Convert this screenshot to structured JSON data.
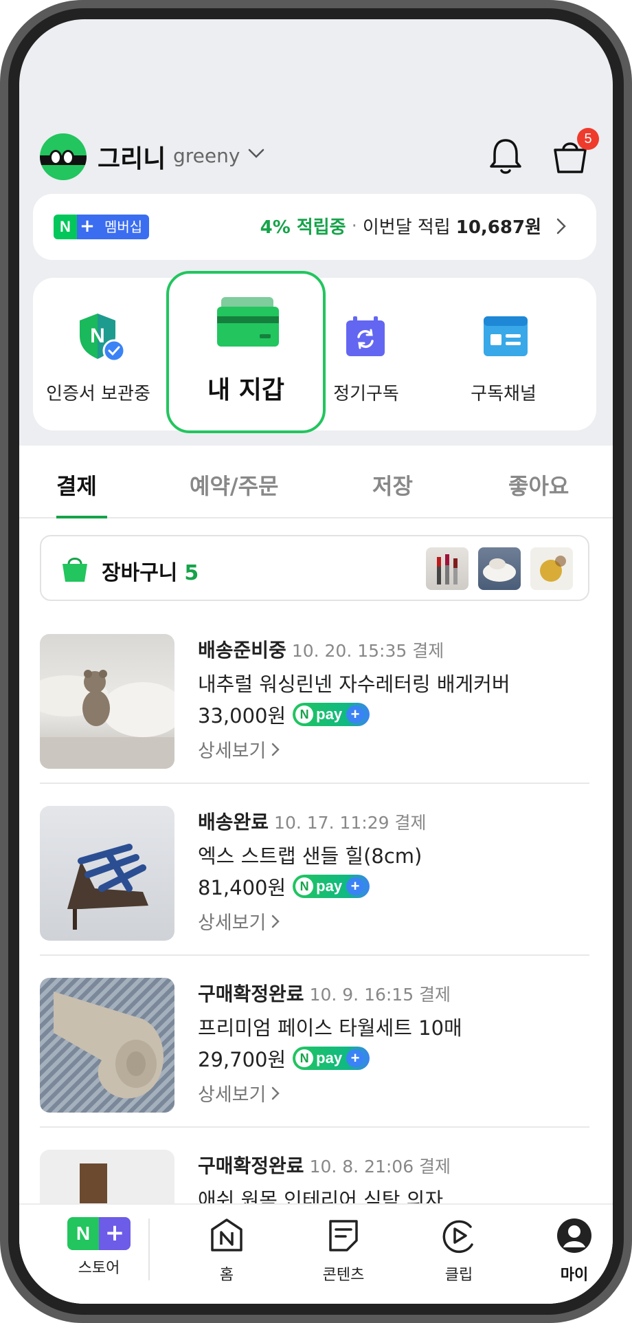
{
  "header": {
    "username": "그리니",
    "userid": "greeny",
    "cart_badge": "5"
  },
  "membership": {
    "badge_n": "N",
    "badge_plus": "+",
    "badge_text": "멤버십",
    "rate": "4% 적립중",
    "separator": "·",
    "month_label": "이번달 적립",
    "amount": "10,687원"
  },
  "quick_menu": {
    "items": [
      {
        "label": "인증서 보관중",
        "icon": "shield-check-icon"
      },
      {
        "label": "내 지갑",
        "icon": "wallet-card-icon"
      },
      {
        "label": "정기구독",
        "icon": "calendar-refresh-icon"
      },
      {
        "label": "구독채널",
        "icon": "channel-card-icon"
      }
    ]
  },
  "tabs": [
    {
      "label": "결제",
      "active": true
    },
    {
      "label": "예약/주문",
      "active": false
    },
    {
      "label": "저장",
      "active": false
    },
    {
      "label": "좋아요",
      "active": false
    }
  ],
  "cart": {
    "title": "장바구니",
    "count": "5"
  },
  "orders": [
    {
      "status": "배송준비중",
      "date": "10. 20. 15:35 결제",
      "name": "내추럴 워싱린넨 자수레터링 배게커버",
      "price": "33,000원",
      "detail": "상세보기"
    },
    {
      "status": "배송완료",
      "date": "10. 17. 11:29 결제",
      "name": "엑스 스트랩 샌들 힐(8cm)",
      "price": "81,400원",
      "detail": "상세보기"
    },
    {
      "status": "구매확정완료",
      "date": "10. 9. 16:15 결제",
      "name": "프리미엄 페이스 타월세트 10매",
      "price": "29,700원",
      "detail": "상세보기"
    },
    {
      "status": "구매확정완료",
      "date": "10. 8. 21:06 결제",
      "name": "애쉬 원목 인테리어 식탁 의자",
      "price": "",
      "detail": ""
    }
  ],
  "npay": {
    "text": "pay",
    "n": "N",
    "plus": "+"
  },
  "bottom_nav": [
    {
      "label": "스토어",
      "icon": "store-n-plus-icon"
    },
    {
      "label": "홈",
      "icon": "home-n-icon"
    },
    {
      "label": "콘텐츠",
      "icon": "content-note-icon"
    },
    {
      "label": "클립",
      "icon": "clip-play-icon"
    },
    {
      "label": "마이",
      "icon": "profile-icon",
      "active": true
    }
  ],
  "colors": {
    "accent_green": "#16a34a",
    "badge_red": "#ef3b2c",
    "membership_blue": "#3b6df0"
  }
}
